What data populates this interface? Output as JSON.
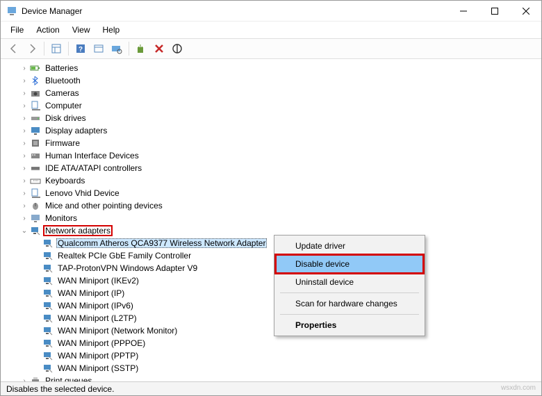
{
  "window": {
    "title": "Device Manager"
  },
  "menu": {
    "file": "File",
    "action": "Action",
    "view": "View",
    "help": "Help"
  },
  "tree": {
    "cats": [
      {
        "label": "Batteries",
        "icon": "battery"
      },
      {
        "label": "Bluetooth",
        "icon": "bt"
      },
      {
        "label": "Cameras",
        "icon": "cam"
      },
      {
        "label": "Computer",
        "icon": "pc"
      },
      {
        "label": "Disk drives",
        "icon": "disk"
      },
      {
        "label": "Display adapters",
        "icon": "disp"
      },
      {
        "label": "Firmware",
        "icon": "fw"
      },
      {
        "label": "Human Interface Devices",
        "icon": "hid"
      },
      {
        "label": "IDE ATA/ATAPI controllers",
        "icon": "ide"
      },
      {
        "label": "Keyboards",
        "icon": "kb"
      },
      {
        "label": "Lenovo Vhid Device",
        "icon": "pc"
      },
      {
        "label": "Mice and other pointing devices",
        "icon": "mouse"
      },
      {
        "label": "Monitors",
        "icon": "mon"
      },
      {
        "label": "Network adapters",
        "icon": "net",
        "expanded": true,
        "boxed": true,
        "children": [
          {
            "label": "Qualcomm Atheros QCA9377 Wireless Network Adapter",
            "sel": true,
            "boxed": true
          },
          {
            "label": "Realtek PCIe GbE Family Controller"
          },
          {
            "label": "TAP-ProtonVPN Windows Adapter V9"
          },
          {
            "label": "WAN Miniport (IKEv2)"
          },
          {
            "label": "WAN Miniport (IP)"
          },
          {
            "label": "WAN Miniport (IPv6)"
          },
          {
            "label": "WAN Miniport (L2TP)"
          },
          {
            "label": "WAN Miniport (Network Monitor)"
          },
          {
            "label": "WAN Miniport (PPPOE)"
          },
          {
            "label": "WAN Miniport (PPTP)"
          },
          {
            "label": "WAN Miniport (SSTP)"
          }
        ]
      },
      {
        "label": "Print queues",
        "icon": "print"
      }
    ]
  },
  "context": {
    "update": "Update driver",
    "disable": "Disable device",
    "uninstall": "Uninstall device",
    "scan": "Scan for hardware changes",
    "props": "Properties"
  },
  "status": {
    "text": "Disables the selected device."
  },
  "watermark": "wsxdn.com"
}
